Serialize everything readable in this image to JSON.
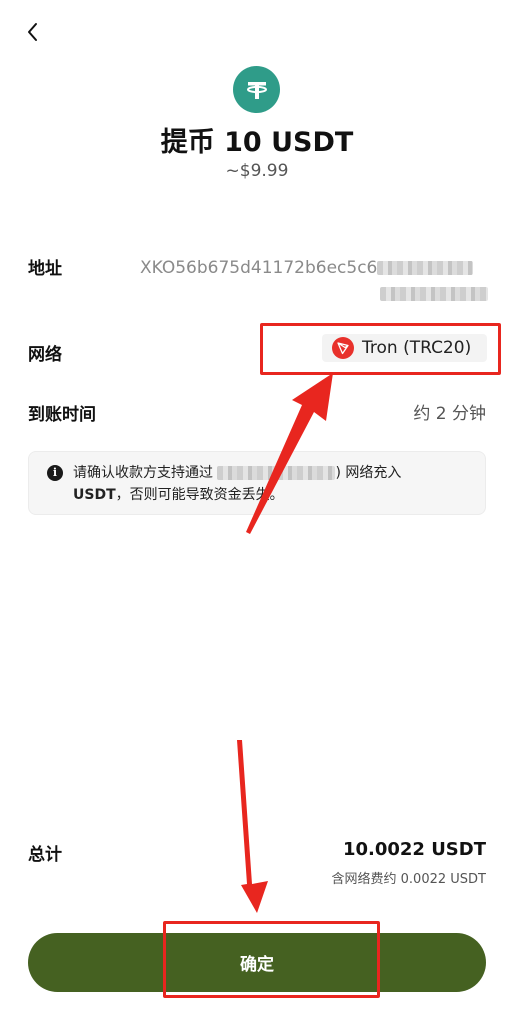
{
  "header": {
    "back_icon": "chevron-left-icon",
    "coin_icon": "tether-icon",
    "title": "提币 10 USDT",
    "subtitle": "~$9.99"
  },
  "details": {
    "address_label": "地址",
    "address_visible": "XKO56b675d41172b6ec5c6",
    "network_label": "网络",
    "network_value": "Tron (TRC20)",
    "network_icon": "tron-icon",
    "eta_label": "到账时间",
    "eta_value": "约 2 分钟"
  },
  "notice": {
    "icon": "info-icon",
    "text_before": "请确认收款方支持通过",
    "text_after": ") 网络充入",
    "token": "USDT",
    "text_end": "，否则可能导致资金丢失。"
  },
  "summary": {
    "total_label": "总计",
    "total_value": "10.0022 USDT",
    "fee_text": "含网络费约 0.0022 USDT"
  },
  "actions": {
    "confirm_label": "确定"
  },
  "colors": {
    "accent": "#456121",
    "coin": "#2f9c89",
    "tron": "#e8312b",
    "annotation": "#e8261f"
  }
}
